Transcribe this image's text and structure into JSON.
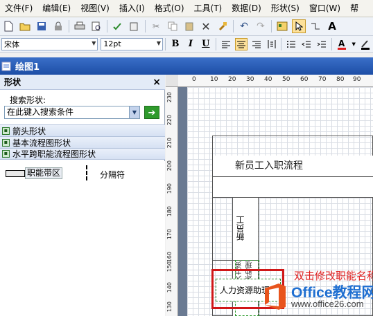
{
  "menu": [
    "文件(F)",
    "编辑(E)",
    "视图(V)",
    "插入(I)",
    "格式(O)",
    "工具(T)",
    "数据(D)",
    "形状(S)",
    "窗口(W)",
    "帮"
  ],
  "toolbar": {
    "font_name": "宋体",
    "font_size": "12pt",
    "bold": "B",
    "italic": "I",
    "underline": "U",
    "text_tool": "A"
  },
  "document": {
    "title": "绘图1"
  },
  "shapes_panel": {
    "title": "形状",
    "close": "×",
    "search_label": "搜索形状:",
    "search_value": "在此键入搜索条件",
    "stencils": [
      "箭头形状",
      "基本流程图形状",
      "水平跨职能流程图形状"
    ],
    "items": [
      {
        "label": "职能带区",
        "icon": "swimlane-shape-icon"
      },
      {
        "label": "分隔符",
        "icon": "separator-shape-icon"
      }
    ]
  },
  "rulers": {
    "horizontal": [
      "0",
      "10",
      "20",
      "30",
      "40",
      "50",
      "60",
      "70",
      "80",
      "90",
      "100"
    ],
    "vertical": [
      "230",
      "220",
      "210",
      "200",
      "190",
      "180",
      "170",
      "160",
      "150",
      "140",
      "130"
    ]
  },
  "diagram": {
    "title": "新员工入职流程",
    "lane1": "新员工",
    "lane2": "人力资源助理",
    "edit_text": "人力资源助理",
    "hint": "双击修改职能名称"
  },
  "watermark": {
    "brand": "Office",
    "brand_cn": "教程网",
    "url": "www.office26.com",
    "colors": {
      "orange": "#e8541d",
      "blue": "#1f6fd1"
    }
  }
}
